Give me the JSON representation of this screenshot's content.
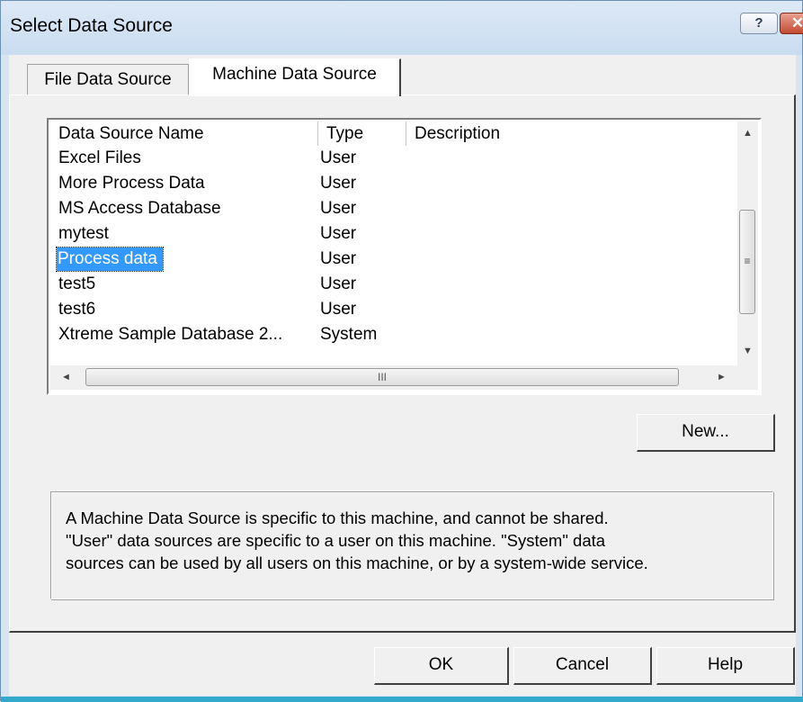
{
  "window": {
    "title": "Select Data Source",
    "help_glyph": "?",
    "close_glyph": "✕"
  },
  "tabs": [
    {
      "label": "File Data Source",
      "selected": false
    },
    {
      "label": "Machine Data Source",
      "selected": true
    }
  ],
  "list": {
    "columns": [
      "Data Source Name",
      "Type",
      "Description"
    ],
    "rows": [
      {
        "name": "Excel Files",
        "type": "User",
        "description": ""
      },
      {
        "name": "More Process Data",
        "type": "User",
        "description": ""
      },
      {
        "name": "MS Access Database",
        "type": "User",
        "description": ""
      },
      {
        "name": "mytest",
        "type": "User",
        "description": ""
      },
      {
        "name": "Process data",
        "type": "User",
        "description": "",
        "selected": true
      },
      {
        "name": "test5",
        "type": "User",
        "description": ""
      },
      {
        "name": "test6",
        "type": "User",
        "description": ""
      },
      {
        "name": "Xtreme Sample Database 2...",
        "type": "System",
        "description": ""
      }
    ],
    "scroll_up": "▲",
    "scroll_down": "▼",
    "scroll_left": "◄",
    "scroll_right": "►",
    "vthumb_grip": "≡",
    "hthumb_grip": "III"
  },
  "buttons": {
    "new": "New...",
    "ok": "OK",
    "cancel": "Cancel",
    "help": "Help"
  },
  "description": {
    "line1": "A Machine Data Source is specific to this machine, and cannot be shared.",
    "line2": "\"User\" data sources are specific to a user on this machine.  \"System\" data",
    "line3": "sources can be used by all users on this machine, or by a system-wide service."
  },
  "colors": {
    "selection": "#3399ff",
    "titlebar": "#c9dcf0",
    "close_button": "#c44a32"
  }
}
